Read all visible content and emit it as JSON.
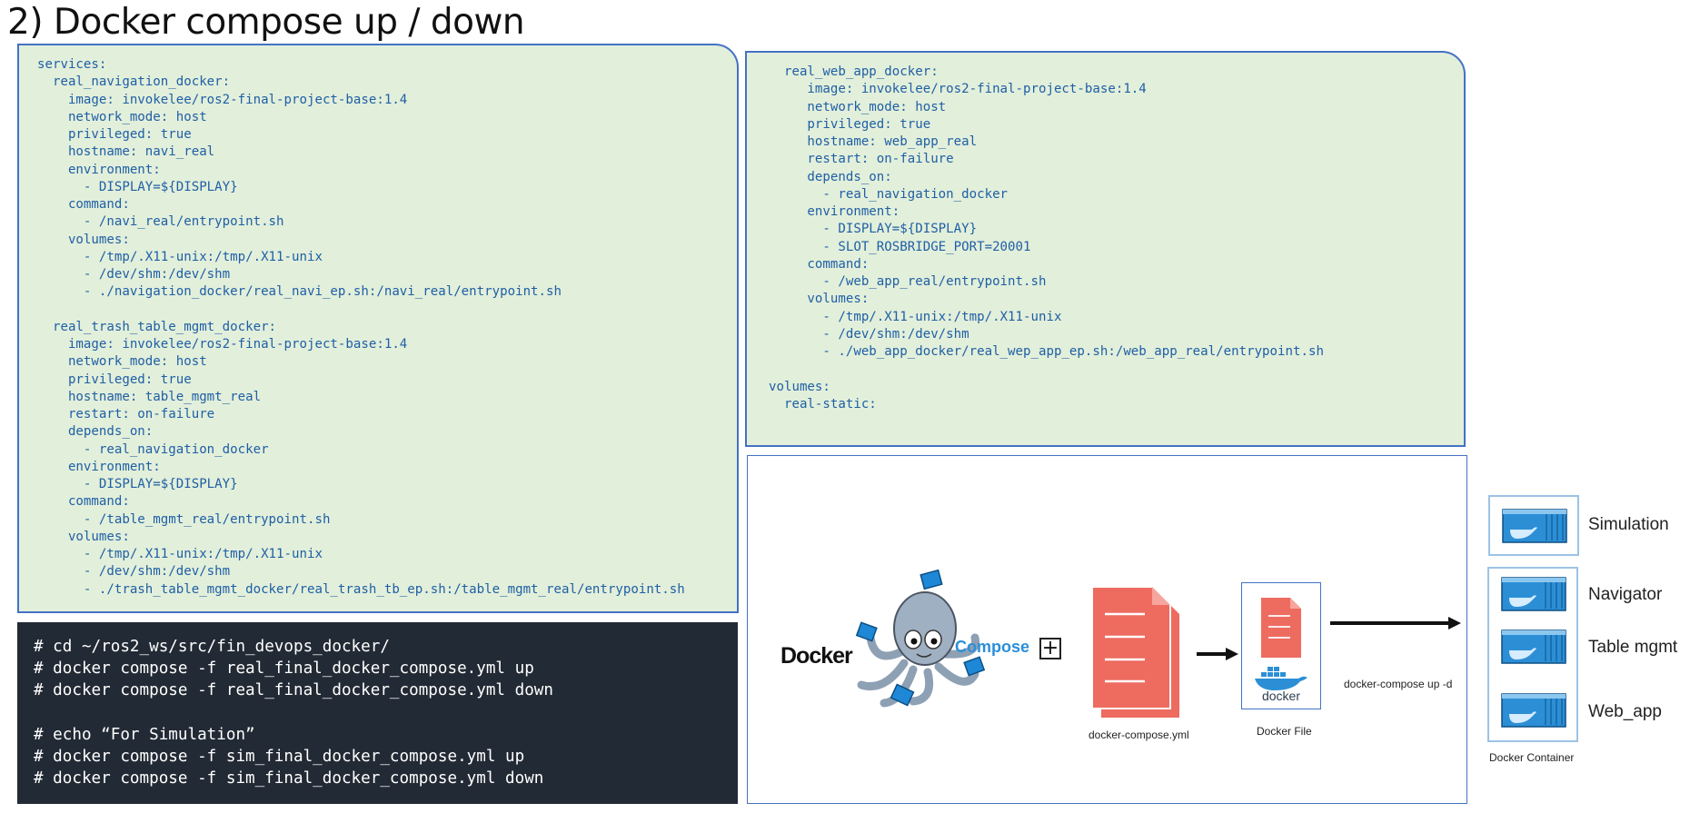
{
  "page": {
    "title": "2) Docker compose up / down"
  },
  "yaml_left": {
    "code": "services:\n  real_navigation_docker:\n    image: invokelee/ros2-final-project-base:1.4\n    network_mode: host\n    privileged: true\n    hostname: navi_real\n    environment:\n      - DISPLAY=${DISPLAY}\n    command:\n      - /navi_real/entrypoint.sh\n    volumes:\n      - /tmp/.X11-unix:/tmp/.X11-unix\n      - /dev/shm:/dev/shm\n      - ./navigation_docker/real_navi_ep.sh:/navi_real/entrypoint.sh\n\n  real_trash_table_mgmt_docker:\n    image: invokelee/ros2-final-project-base:1.4\n    network_mode: host\n    privileged: true\n    hostname: table_mgmt_real\n    restart: on-failure\n    depends_on:\n      - real_navigation_docker\n    environment:\n      - DISPLAY=${DISPLAY}\n    command:\n      - /table_mgmt_real/entrypoint.sh\n    volumes:\n      - /tmp/.X11-unix:/tmp/.X11-unix\n      - /dev/shm:/dev/shm\n      - ./trash_table_mgmt_docker/real_trash_tb_ep.sh:/table_mgmt_real/entrypoint.sh"
  },
  "yaml_right": {
    "code": "  real_web_app_docker:\n     image: invokelee/ros2-final-project-base:1.4\n     network_mode: host\n     privileged: true\n     hostname: web_app_real\n     restart: on-failure\n     depends_on:\n       - real_navigation_docker\n     environment:\n       - DISPLAY=${DISPLAY}\n       - SLOT_ROSBRIDGE_PORT=20001\n     command:\n       - /web_app_real/entrypoint.sh\n     volumes:\n       - /tmp/.X11-unix:/tmp/.X11-unix\n       - /dev/shm:/dev/shm\n       - ./web_app_docker/real_wep_app_ep.sh:/web_app_real/entrypoint.sh\n\nvolumes:\n  real-static:"
  },
  "terminal": {
    "code": "# cd ~/ros2_ws/src/fin_devops_docker/\n# docker compose -f real_final_docker_compose.yml up\n# docker compose -f real_final_docker_compose.yml down\n\n# echo “For Simulation”\n# docker compose -f sim_final_docker_compose.yml up\n# docker compose -f sim_final_docker_compose.yml down"
  },
  "diagram": {
    "docker_word": "Docker",
    "compose_word": "Compose",
    "plus_symbol": "+",
    "compose_file_label": "docker-compose.yml",
    "dockerfile_label": "Docker File",
    "docker_logo_text": "docker",
    "command_label": "docker-compose up -d",
    "container_caption": "Docker Container",
    "containers": [
      {
        "name": "Simulation"
      },
      {
        "name": "Navigator"
      },
      {
        "name": "Table mgmt"
      },
      {
        "name": "Web_app"
      }
    ],
    "colors": {
      "doc_red": "#ee6b60",
      "frame_blue": "#4472c4",
      "container_blue": "#2c8fd6",
      "octopus": "#9aaabb"
    }
  }
}
